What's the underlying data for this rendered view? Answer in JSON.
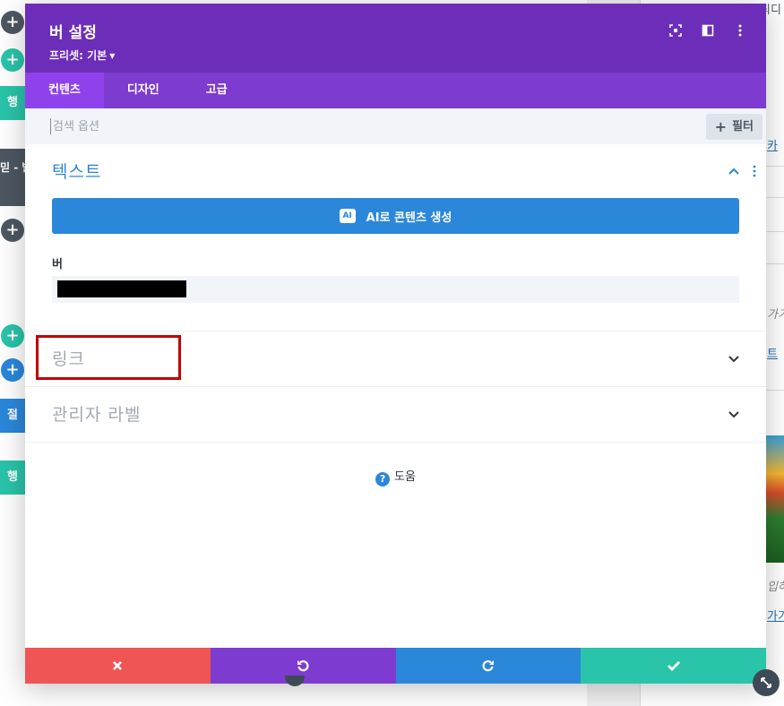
{
  "modal": {
    "title": "버 설정",
    "preset": "프리셋: 기본",
    "tabs": [
      {
        "label": "컨텐츠",
        "active": true
      },
      {
        "label": "디자인",
        "active": false
      },
      {
        "label": "고급",
        "active": false
      }
    ],
    "search_placeholder": "검색 옵션",
    "filter_label": "필터",
    "sections": {
      "text": {
        "title": "텍스트",
        "ai_button": "AI로 콘텐츠 생성",
        "ai_badge": "AI",
        "field_label": "버"
      },
      "link": {
        "title": "링크"
      },
      "admin_label": {
        "title": "관리자 라벨"
      }
    },
    "help_label": "도움",
    "colors": {
      "header": "#6c2eb9",
      "tabs": "#7d3bcf",
      "active_tab": "#8f42ec",
      "primary": "#2b87da",
      "cancel": "#ef5555",
      "undo": "#7e3bd0",
      "redo": "#2b87da",
      "save": "#29c4a9",
      "highlight": "#c00000"
    },
    "icons": {
      "header": [
        "focus-icon",
        "columns-icon",
        "more-vertical-icon"
      ],
      "footer": [
        "close-icon",
        "undo-icon",
        "redo-icon",
        "check-icon"
      ]
    }
  },
  "background": {
    "left_tabs": [
      "행",
      "절",
      "행"
    ],
    "left_dark_tab": "믿 - 발미",
    "right_texts": [
      "최디",
      "카",
      "가기",
      "트",
      "입하",
      "가기"
    ]
  }
}
